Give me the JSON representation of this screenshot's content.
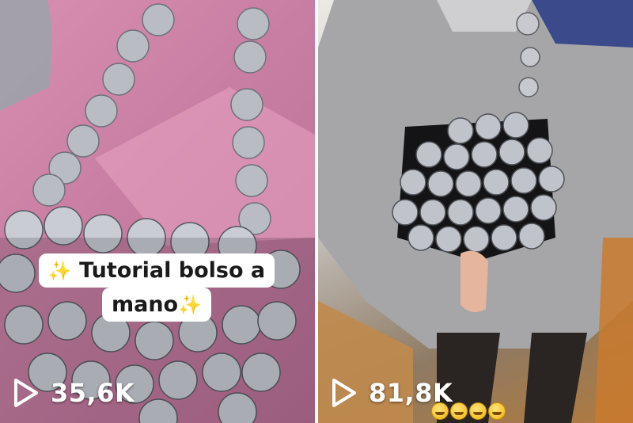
{
  "tiles": [
    {
      "caption_line1": "Tutorial bolso a",
      "caption_line2": "mano",
      "sparkle_icon": "sparkles-icon",
      "views": "35,6K",
      "accent": "#d98fb0"
    },
    {
      "views": "81,8K",
      "emoji_icon": "grimacing-face-icon",
      "emoji_count": 4,
      "accent": "#b07a3e"
    }
  ],
  "colors": {
    "caption_bg": "#ffffff",
    "caption_text": "#1a1a1a",
    "sparkle": "#f5c518",
    "views_text": "#ffffff"
  }
}
